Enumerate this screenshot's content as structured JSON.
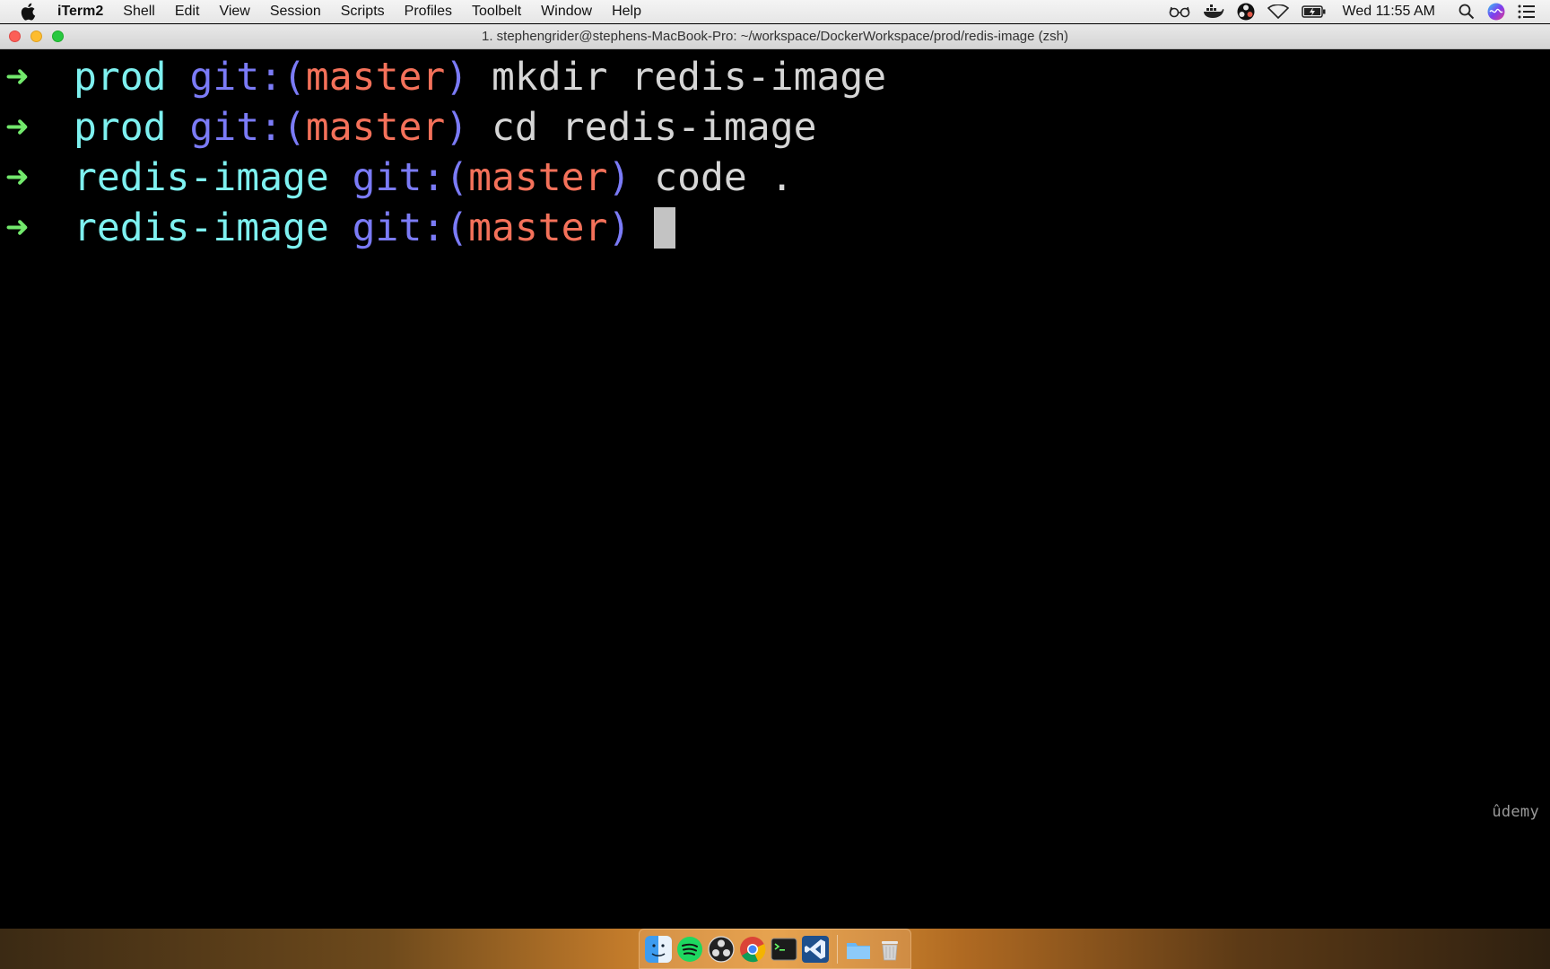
{
  "menubar": {
    "app_name": "iTerm2",
    "items": [
      "Shell",
      "Edit",
      "View",
      "Session",
      "Scripts",
      "Profiles",
      "Toolbelt",
      "Window",
      "Help"
    ],
    "clock": "Wed 11:55 AM"
  },
  "window": {
    "title": "1. stephengrider@stephens-MacBook-Pro: ~/workspace/DockerWorkspace/prod/redis-image (zsh)"
  },
  "terminal": {
    "prompt_arrow": "➜",
    "git_prefix": "git:(",
    "git_suffix": ")",
    "lines": [
      {
        "dir": "prod",
        "branch": "master",
        "command": "mkdir redis-image"
      },
      {
        "dir": "prod",
        "branch": "master",
        "command": "cd redis-image"
      },
      {
        "dir": "redis-image",
        "branch": "master",
        "command": "code ."
      },
      {
        "dir": "redis-image",
        "branch": "master",
        "command": ""
      }
    ]
  },
  "watermark": "ûdemy",
  "dock": {
    "apps": [
      "finder-icon",
      "spotify-icon",
      "obs-icon",
      "chrome-icon",
      "terminal-icon",
      "vscode-icon",
      "downloads-folder-icon",
      "trash-icon"
    ]
  },
  "colors": {
    "arrow": "#72e86c",
    "dir": "#7ef1f0",
    "git": "#7b7bf7",
    "branch": "#f4715a",
    "command": "#d6d6d6"
  }
}
